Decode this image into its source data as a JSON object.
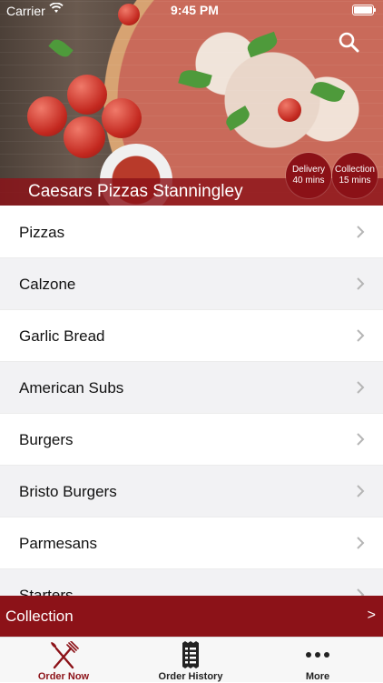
{
  "status_bar": {
    "carrier": "Carrier",
    "time": "9:45 PM"
  },
  "header": {
    "restaurant_name": "Caesars Pizzas Stanningley",
    "delivery": {
      "label": "Delivery",
      "time": "40 mins"
    },
    "collection": {
      "label": "Collection",
      "time": "15 mins"
    }
  },
  "menu": {
    "items": [
      {
        "label": "Pizzas"
      },
      {
        "label": "Calzone"
      },
      {
        "label": "Garlic Bread"
      },
      {
        "label": "American Subs"
      },
      {
        "label": "Burgers"
      },
      {
        "label": "Bristo Burgers"
      },
      {
        "label": "Parmesans"
      },
      {
        "label": "Starters"
      }
    ]
  },
  "collection_bar": {
    "label": "Collection",
    "arrow": ">"
  },
  "tab_bar": {
    "tabs": [
      {
        "label": "Order Now",
        "icon": "fork-knife-icon"
      },
      {
        "label": "Order History",
        "icon": "receipt-icon"
      },
      {
        "label": "More",
        "icon": "more-icon"
      }
    ]
  },
  "colors": {
    "brand": "#8c1218",
    "accent_tab": "#8c1218",
    "list_alt": "#f2f2f4"
  }
}
